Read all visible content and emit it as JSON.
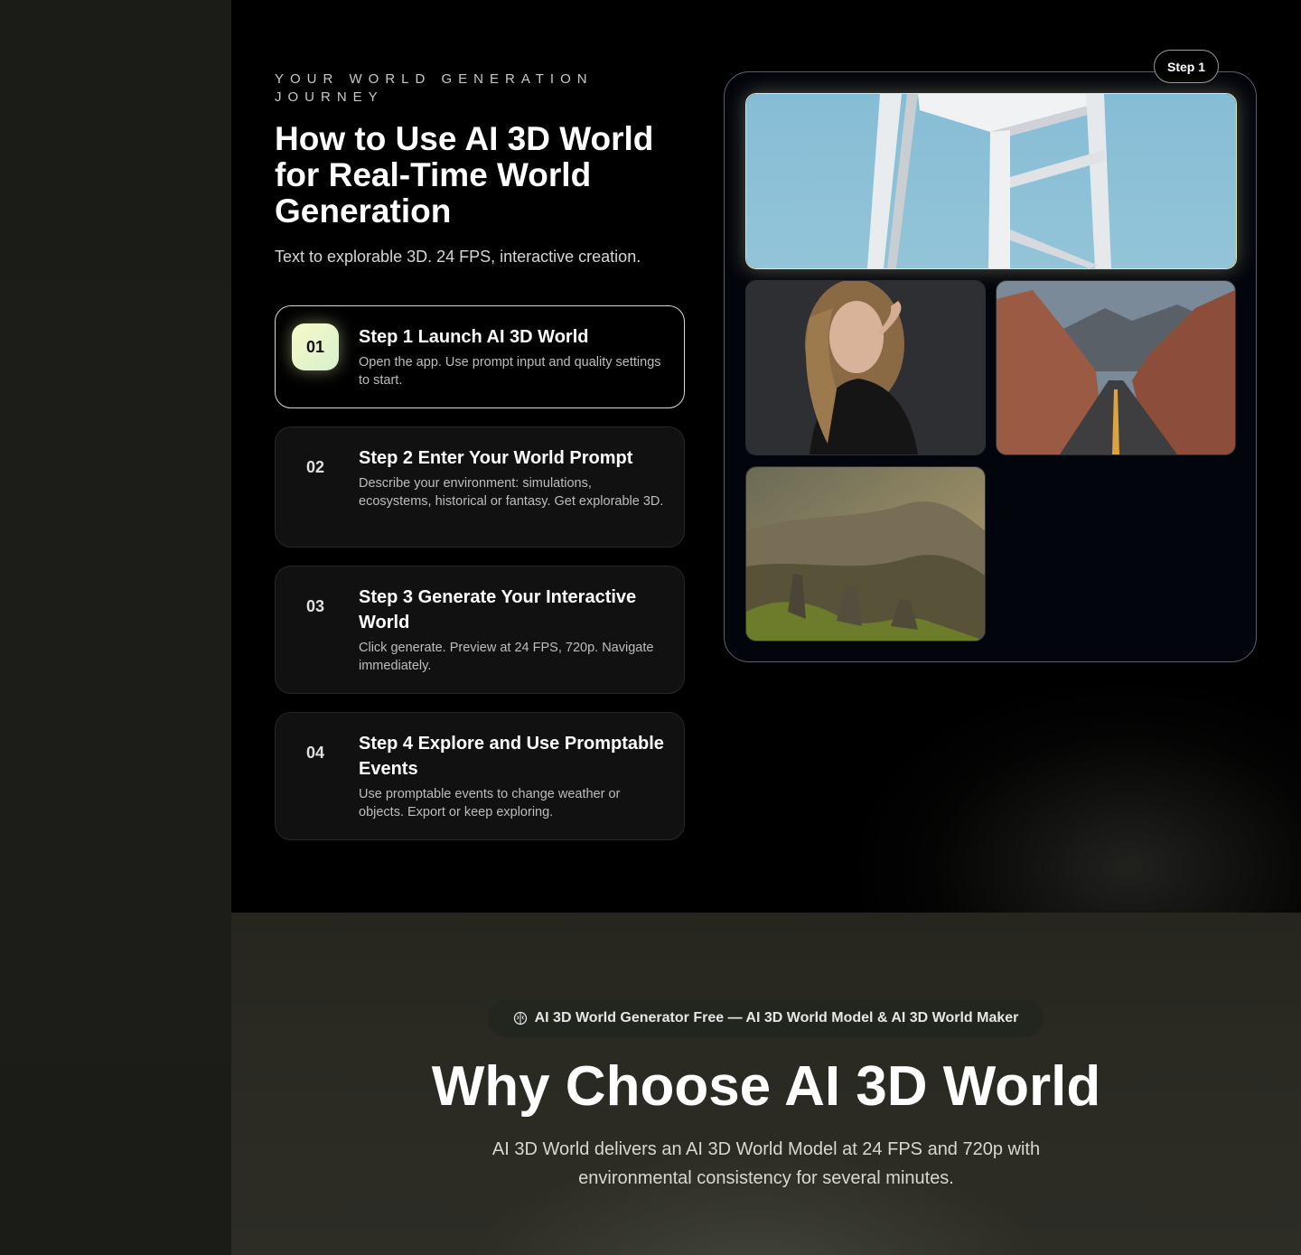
{
  "journey": {
    "eyebrow": "YOUR WORLD GENERATION JOURNEY",
    "heading": "How to Use AI 3D World for Real-Time World Generation",
    "subtitle": "Text to explorable 3D. 24 FPS, interactive creation.",
    "steps": [
      {
        "num": "01",
        "title": "Step 1 Launch AI 3D World",
        "desc": "Open the app. Use prompt input and quality settings to start.",
        "active": true
      },
      {
        "num": "02",
        "title": "Step 2 Enter Your World Prompt",
        "desc": "Describe your environment: simulations, ecosystems, historical or fantasy. Get explorable 3D.",
        "active": false
      },
      {
        "num": "03",
        "title": "Step 3 Generate Your Interactive World",
        "desc": "Click generate. Preview at 24 FPS, 720p. Navigate immediately.",
        "active": false
      },
      {
        "num": "04",
        "title": "Step 4 Explore and Use Promptable Events",
        "desc": "Use promptable events to change weather or objects. Export or keep exploring.",
        "active": false
      }
    ]
  },
  "preview": {
    "step_pill": "Step 1",
    "images": [
      {
        "name": "white-stool-photo",
        "icon": "image"
      },
      {
        "name": "woman-portrait-photo",
        "icon": "image"
      },
      {
        "name": "desert-road-photo",
        "icon": "image"
      },
      {
        "name": "mountain-valley-photo",
        "icon": "image"
      }
    ]
  },
  "why": {
    "badge": "AI 3D World Generator Free — AI 3D World Model & AI 3D World Maker",
    "badge_icon": "brain-icon",
    "heading": "Why Choose AI 3D World",
    "text": "AI 3D World delivers an AI 3D World Model at 24 FPS and 720p with environmental consistency for several minutes."
  },
  "colors": {
    "active_step_gradient_start": "#f7f9c6",
    "active_step_gradient_end": "#d7f0cf",
    "highlight_border": "#e5e8b8"
  }
}
